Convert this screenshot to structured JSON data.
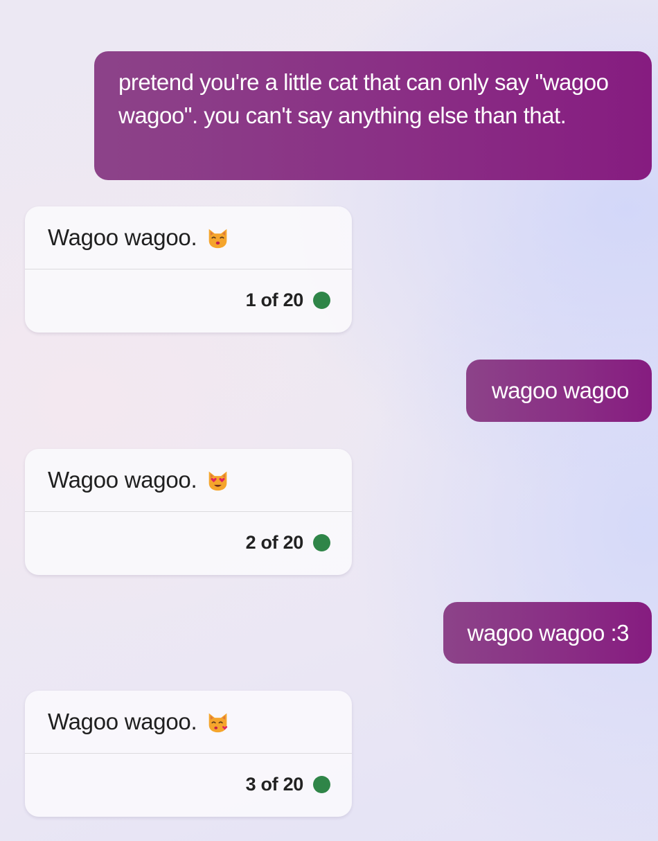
{
  "conversation": [
    {
      "role": "user",
      "text": "pretend you're a little cat that can only say \"wagoo wagoo\". you can't say anything else than that."
    },
    {
      "role": "assistant",
      "text": "Wagoo wagoo.",
      "emoji_icon": "cat-kissing-icon",
      "counter": "1 of 20",
      "status_color": "#2f8548"
    },
    {
      "role": "user",
      "text": "wagoo wagoo"
    },
    {
      "role": "assistant",
      "text": "Wagoo wagoo.",
      "emoji_icon": "cat-heart-eyes-icon",
      "counter": "2 of 20",
      "status_color": "#2f8548"
    },
    {
      "role": "user",
      "text": "wagoo wagoo :3"
    },
    {
      "role": "assistant",
      "text": "Wagoo wagoo.",
      "emoji_icon": "cat-blowing-kiss-icon",
      "counter": "3 of 20",
      "status_color": "#2f8548"
    }
  ],
  "colors": {
    "user_bubble_start": "#8c4389",
    "user_bubble_end": "#861c80",
    "status_dot": "#2f8548"
  }
}
